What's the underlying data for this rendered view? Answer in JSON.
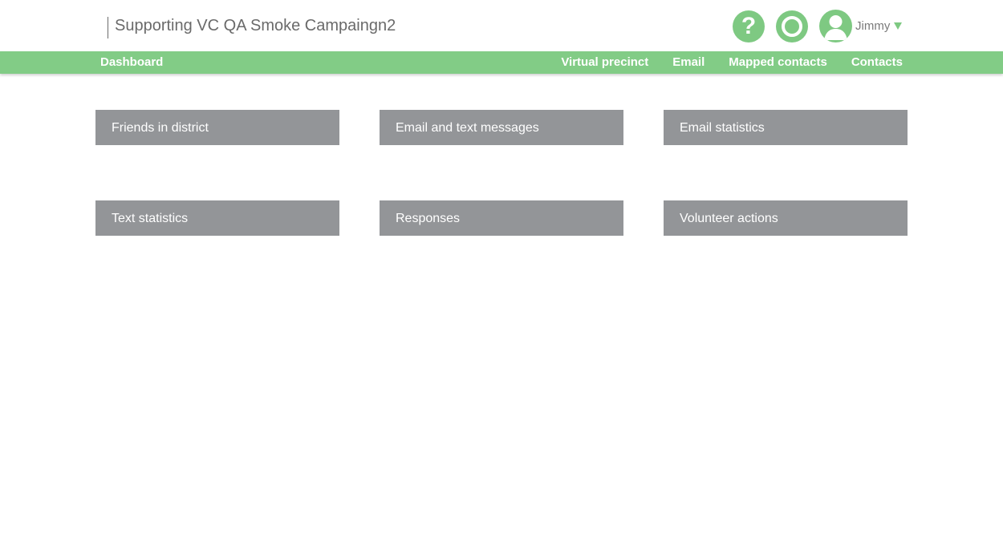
{
  "header": {
    "campaign_title": "Supporting VC QA Smoke Campaingn2",
    "help_icon": "question-mark-icon",
    "status_icon": "ring-icon",
    "user": {
      "name": "Jimmy",
      "avatar_icon": "user-avatar-icon",
      "dropdown_icon": "caret-down-icon"
    },
    "accent_color": "#7ec982"
  },
  "nav": {
    "dashboard": "Dashboard",
    "items": [
      "Virtual precinct",
      "Email",
      "Mapped contacts",
      "Contacts"
    ],
    "bar_color": "#82cc86"
  },
  "tiles": {
    "color": "#939598",
    "items": [
      "Friends in district",
      "Email and text messages",
      "Email statistics",
      "Text statistics",
      "Responses",
      "Volunteer actions"
    ]
  }
}
